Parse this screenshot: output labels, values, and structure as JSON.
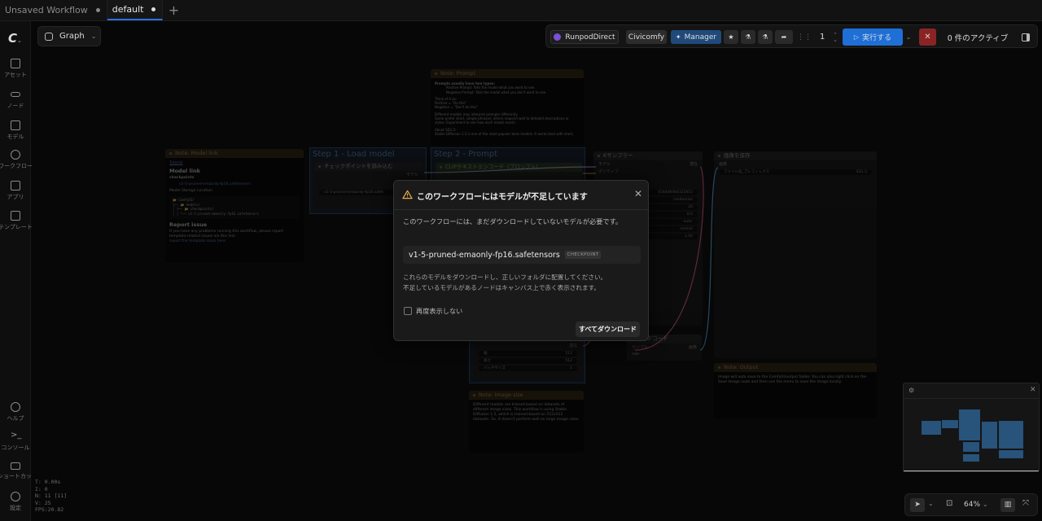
{
  "tabs": [
    {
      "label": "Unsaved Workflow",
      "active": false
    },
    {
      "label": "default",
      "active": true
    }
  ],
  "graph_menu": {
    "label": "Graph"
  },
  "sidebar": {
    "items": [
      {
        "label": "アセット",
        "icon": "assets-icon"
      },
      {
        "label": "ノード",
        "icon": "node-icon"
      },
      {
        "label": "モデル",
        "icon": "model-icon"
      },
      {
        "label": "ワークフロー",
        "icon": "workflow-icon"
      },
      {
        "label": "アプリ",
        "icon": "app-icon"
      },
      {
        "label": "テンプレート",
        "icon": "template-icon"
      },
      {
        "label": "ヘルプ",
        "icon": "help-icon"
      },
      {
        "label": "コンソール",
        "icon": "console-icon"
      },
      {
        "label": "ショートカット",
        "icon": "keyboard-icon"
      },
      {
        "label": "設定",
        "icon": "settings-icon"
      }
    ]
  },
  "stats": [
    "T: 0.00s",
    "I: 0",
    "N: 11 [11]",
    "V: 25",
    "FPS:20.82"
  ],
  "toolbar": {
    "runpod_label": "RunpodDirect",
    "civicomfy_label": "Civicomfy",
    "manager_label": "Manager",
    "queue_count": "1",
    "run_label": "実行する",
    "active_label": "0 件のアクティブ"
  },
  "nodes": {
    "note_prompt": {
      "title": "Note: Prompt",
      "lines": [
        "Prompts usually have two types:",
        "Positive Prompt: Tells the model what you want to see.",
        "Negative Prompt: Tells the model what you don't want to see.",
        "Think of it as:",
        "Positive = \"Do this\"",
        "Negative = \"Don't do this\"",
        "Different models may interpret prompts differently.",
        "Some prefer short, simple phrases; others respond well to detailed descriptions or styles. Experiment to see how each model reacts.",
        "About SD1.5:",
        "Stable Diffusion 1.5 is one of the most popular base models. It works best with short,"
      ]
    },
    "note_model": {
      "title": "Note: Model link",
      "tutorial": "Tutorial",
      "heading": "Model link",
      "sub": "checkpoints",
      "link": "v1-5-pruned-emaonly-fp16.safetensors",
      "storage": "Model Storage Location",
      "tree": [
        "📂 ComfyUI/",
        "├── 📂 models/",
        "│   ├── 📂 checkpoints/",
        "│   │   └── v1-5-pruned-emaonly-fp16.safetensors"
      ],
      "report_heading": "Report issue",
      "report_text": "If you have any problems running this workflow, please report template-related issues via this link:",
      "report_link": "report the template issue here"
    },
    "step1": {
      "title": "Step 1 - Load model",
      "node": "チェックポイントを読み込む",
      "out": "モデル",
      "value": "v1-5-pruned-emaonly-fp16.safet"
    },
    "step2": {
      "title": "Step 2 - Prompt",
      "node": "CLIPテキストエンコード（プロンプト）"
    },
    "ksampler": {
      "title": "Kサンプラー",
      "in_model": "モデル",
      "in_pos": "ポジティブ",
      "out": "潜在",
      "values": [
        "454848484323815",
        "randomize",
        "20",
        "8.0",
        "euler",
        "normal",
        "1.00"
      ]
    },
    "save": {
      "title": "画像を保存",
      "in": "画像",
      "prefix_label": "ファイル名_プレフィックス",
      "prefix_value": "SD1.5"
    },
    "vae": {
      "title": "VAEデコード",
      "in1": "サンプル",
      "in2": "vae",
      "out": "画像"
    },
    "latent": {
      "out": "潜在",
      "rows": [
        {
          "k": "幅",
          "v": "512"
        },
        {
          "k": "高さ",
          "v": "512"
        },
        {
          "k": "バッチサイズ",
          "v": "1"
        }
      ]
    },
    "note_output": {
      "title": "Note: Output",
      "text": "Image will auto save to the ComfyUI/output folder. You can also right click on the Save Image node and then use the menu to save the image locally."
    },
    "note_image": {
      "title": "Note: Image size",
      "text": "Different models are trained based on datasets of different image sizes. This workflow is using Stable Diffusion 1.5, which is trained based on 512x512 datasets. So, it doesn't perform well on large image sizes."
    }
  },
  "dialog": {
    "title": "このワークフローにはモデルが不足しています",
    "description": "このワークフローには、まだダウンロードしていないモデルが必要です。",
    "model_name": "v1-5-pruned-emaonly-fp16.safetensors",
    "badge": "CHECKPOINT",
    "info1": "これらのモデルをダウンロードし、正しいフォルダに配置してください。",
    "info2": "不足しているモデルがあるノードはキャンバス上で赤く表示されます。",
    "checkbox_label": "再度表示しない",
    "download_all": "すべてダウンロード"
  },
  "zoom": "64%"
}
